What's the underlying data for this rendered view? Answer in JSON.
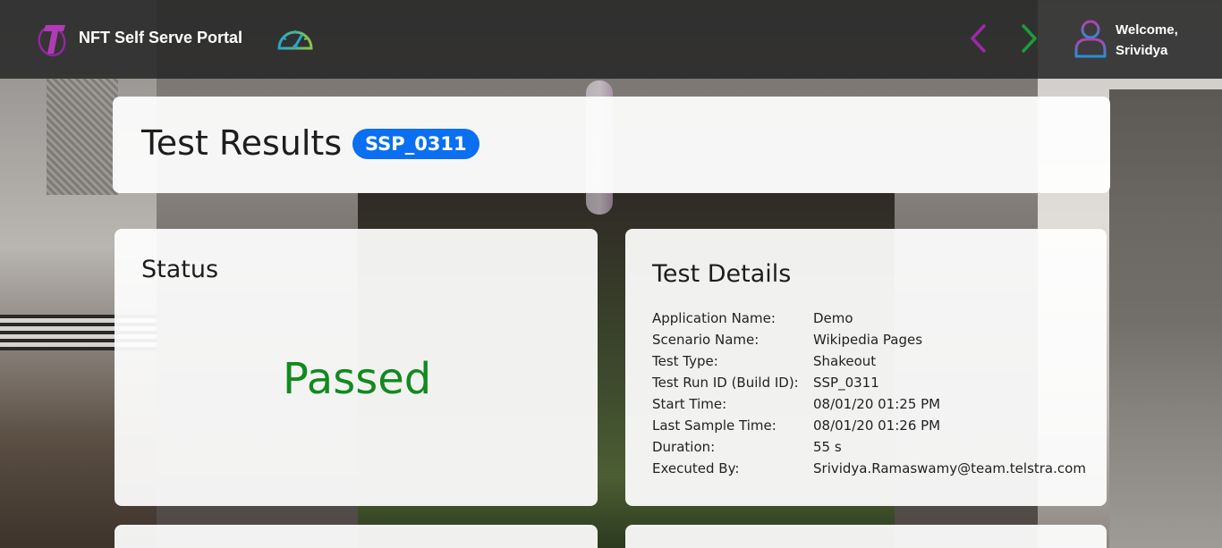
{
  "header": {
    "app_title": "NFT Self Serve Portal",
    "welcome_line1": "Welcome,",
    "welcome_line2": "Srividya",
    "icons": {
      "logo": "telstra-logo-icon",
      "dashboard": "speedometer-icon",
      "back": "chevron-left-icon",
      "forward": "chevron-right-icon",
      "user": "user-icon"
    },
    "colors": {
      "back_arrow": "#9b2aa8",
      "forward_arrow": "#1e9a3c"
    }
  },
  "title_card": {
    "title": "Test Results",
    "run_badge": "SSP_0311",
    "badge_color": "#0a6ff0"
  },
  "status_card": {
    "title": "Status",
    "value": "Passed",
    "value_color": "#118a1e"
  },
  "details_card": {
    "title": "Test Details",
    "rows": [
      {
        "label": "Application Name:",
        "value": "Demo"
      },
      {
        "label": "Scenario Name:",
        "value": "Wikipedia Pages"
      },
      {
        "label": "Test Type:",
        "value": "Shakeout"
      },
      {
        "label": "Test Run ID (Build ID):",
        "value": "SSP_0311"
      },
      {
        "label": "Start Time:",
        "value": "08/01/20 01:25 PM"
      },
      {
        "label": "Last Sample Time:",
        "value": "08/01/20 01:26 PM"
      },
      {
        "label": "Duration:",
        "value": "55 s"
      },
      {
        "label": "Executed By:",
        "value": "Srividya.Ramaswamy@team.telstra.com"
      }
    ]
  }
}
